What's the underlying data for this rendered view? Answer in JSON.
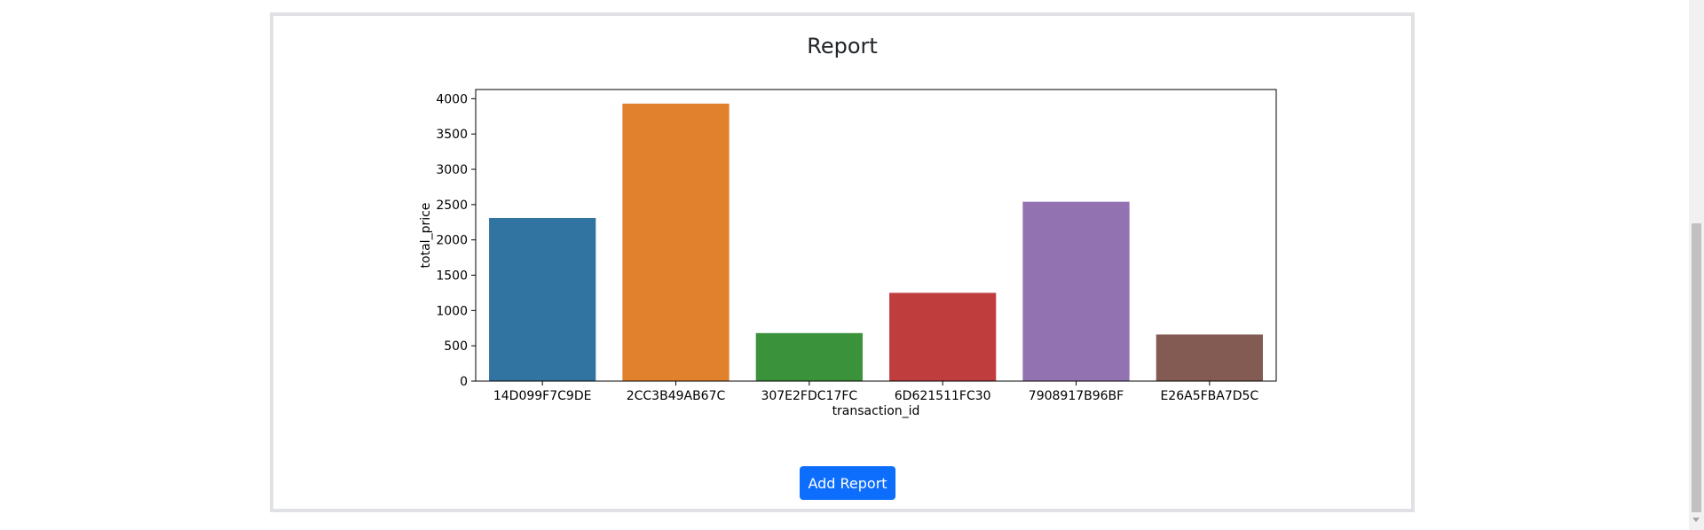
{
  "report": {
    "title": "Report",
    "add_button_label": "Add Report"
  },
  "chart_data": {
    "type": "bar",
    "title": "",
    "xlabel": "transaction_id",
    "ylabel": "total_price",
    "categories": [
      "14D099F7C9DE",
      "2CC3B49AB67C",
      "307E2FDC17FC",
      "6D621511FC30",
      "7908917B96BF",
      "E26A5FBA7D5C"
    ],
    "values": [
      2310,
      3930,
      680,
      1250,
      2540,
      660
    ],
    "ylim": [
      0,
      4130
    ],
    "yticks": [
      0,
      500,
      1000,
      1500,
      2000,
      2500,
      3000,
      3500,
      4000
    ],
    "colors": [
      "#3274a1",
      "#e1812c",
      "#3a923a",
      "#c03d3e",
      "#9372b2",
      "#845b53"
    ],
    "grid": false,
    "legend": "none"
  }
}
